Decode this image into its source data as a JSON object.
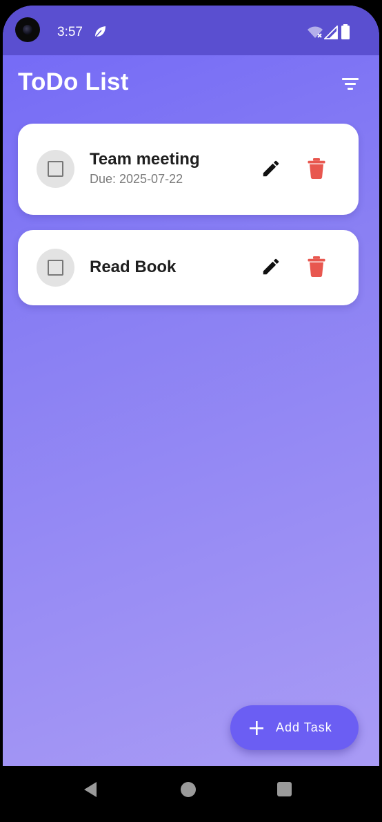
{
  "status_bar": {
    "time": "3:57",
    "icons": [
      "leaf-icon",
      "wifi-icon",
      "signal-icon",
      "battery-icon"
    ]
  },
  "app": {
    "title": "ToDo List",
    "filter_icon": "filter-icon"
  },
  "tasks": [
    {
      "title": "Team meeting",
      "due": "Due: 2025-07-22",
      "completed": false
    },
    {
      "title": "Read Book",
      "due": "",
      "completed": false
    }
  ],
  "fab": {
    "label": "Add Task",
    "icon": "plus-icon"
  },
  "colors": {
    "gradient_top": "#7268f6",
    "gradient_bottom": "#a99bf5",
    "status_bar": "#5a4fd0",
    "fab": "#6b5ef3",
    "delete": "#e8574f",
    "card": "#ffffff"
  },
  "nav_bar": {
    "icons": [
      "back-icon",
      "home-icon",
      "recents-icon"
    ]
  }
}
